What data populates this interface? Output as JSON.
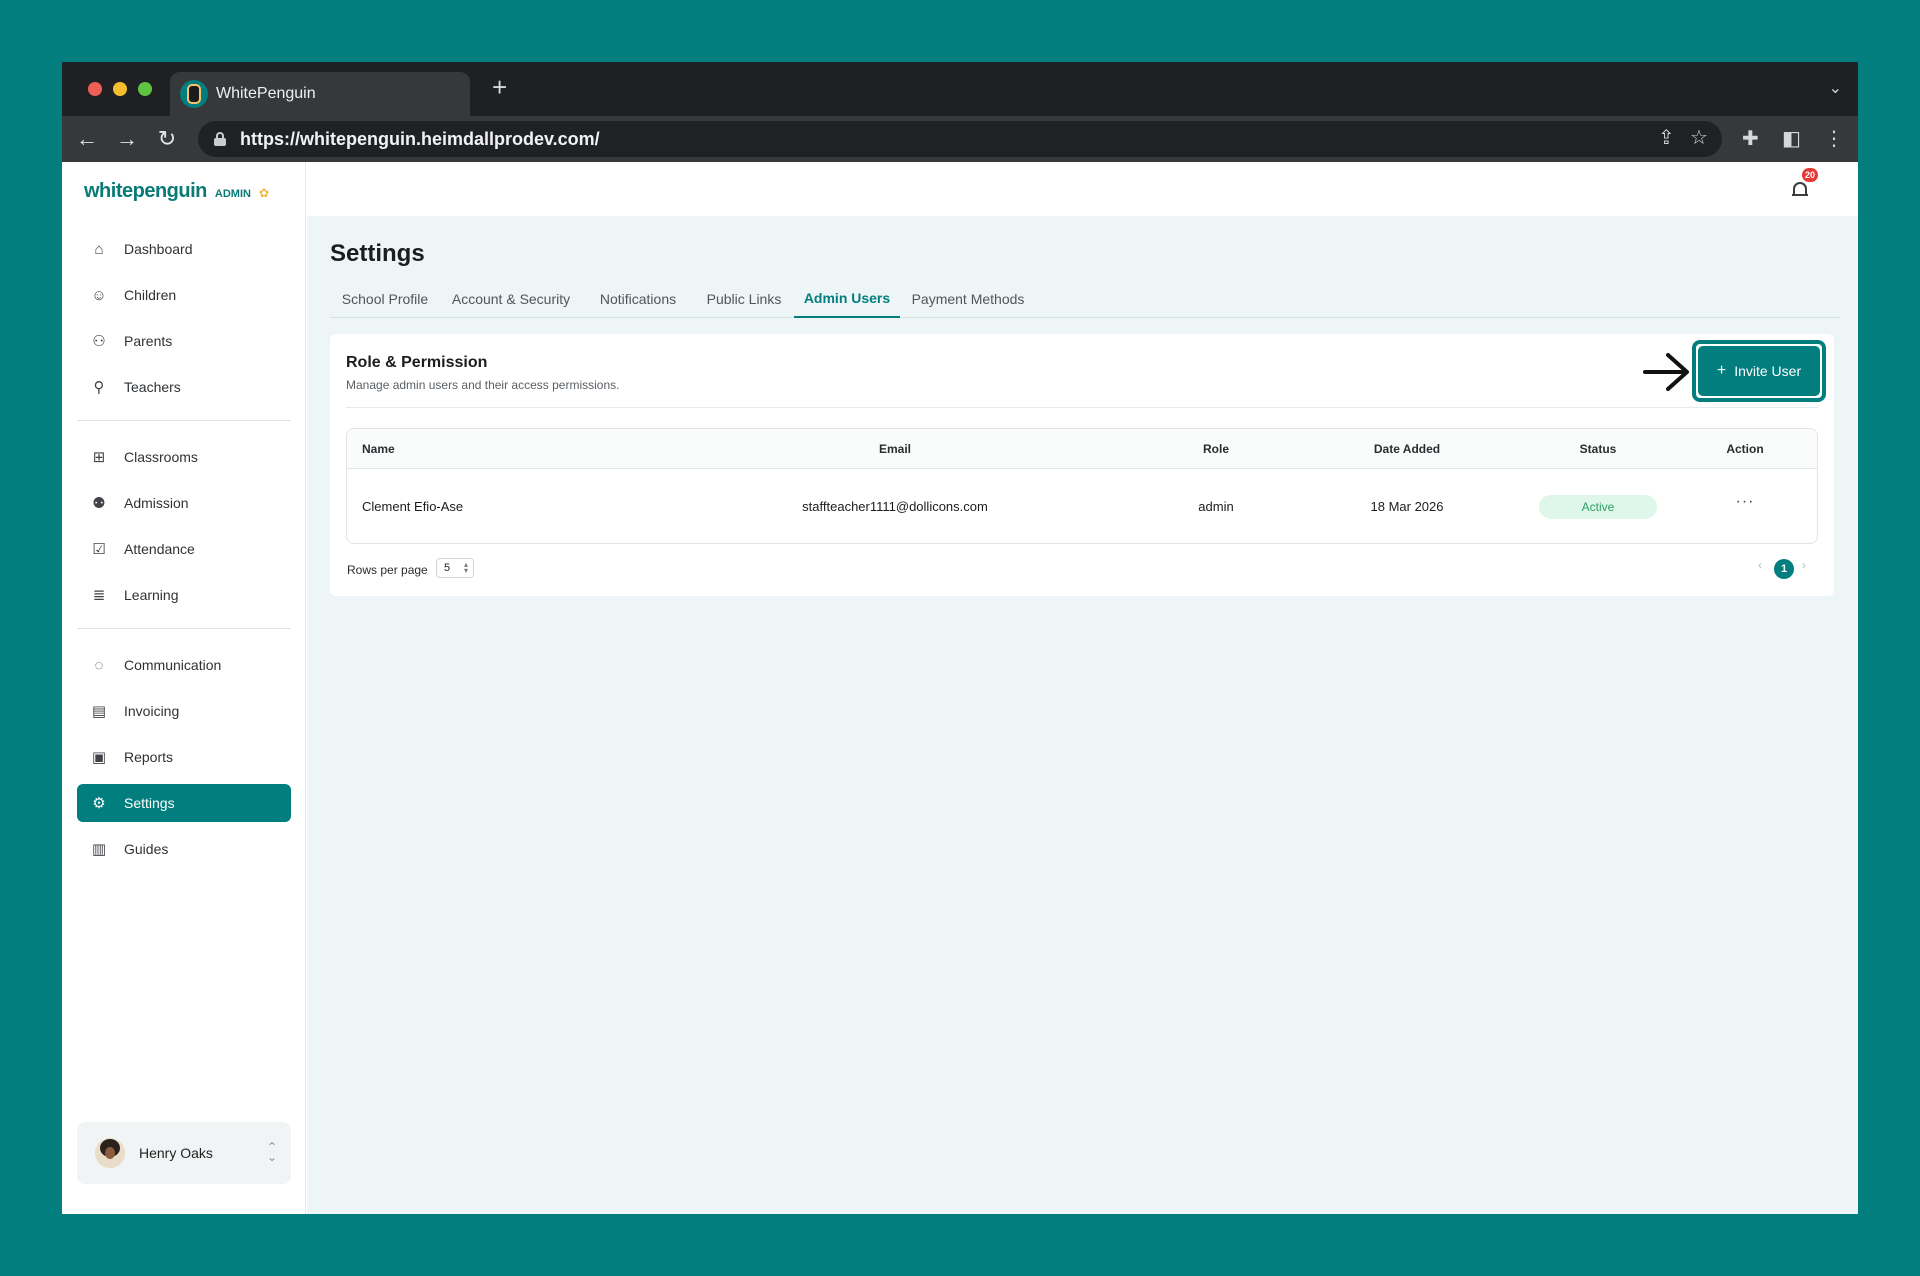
{
  "browser": {
    "tab_title": "WhitePenguin",
    "new_tab_symbol": "+",
    "url": "https://whitepenguin.heimdallprodev.com/"
  },
  "brand": {
    "logo_text": "whitepenguin",
    "admin_label": "ADMIN",
    "accent_color": "#037e7e"
  },
  "sidebar": {
    "items": [
      {
        "label": "Dashboard",
        "icon": "dashboard-icon"
      },
      {
        "label": "Children",
        "icon": "children-icon"
      },
      {
        "label": "Parents",
        "icon": "parents-icon"
      },
      {
        "label": "Teachers",
        "icon": "teachers-icon"
      },
      {
        "label": "Classrooms",
        "icon": "classrooms-icon"
      },
      {
        "label": "Admission",
        "icon": "admission-icon"
      },
      {
        "label": "Attendance",
        "icon": "attendance-icon"
      },
      {
        "label": "Learning",
        "icon": "learning-icon"
      },
      {
        "label": "Communication",
        "icon": "communication-icon"
      },
      {
        "label": "Invoicing",
        "icon": "invoicing-icon"
      },
      {
        "label": "Reports",
        "icon": "reports-icon"
      },
      {
        "label": "Settings",
        "icon": "settings-icon"
      },
      {
        "label": "Guides",
        "icon": "guides-icon"
      }
    ],
    "active_item": "Settings",
    "user_name": "Henry Oaks"
  },
  "header": {
    "notification_count": "20"
  },
  "page": {
    "title": "Settings",
    "tabs": [
      {
        "label": "School Profile"
      },
      {
        "label": "Account & Security"
      },
      {
        "label": "Notifications"
      },
      {
        "label": "Public Links"
      },
      {
        "label": "Admin Users"
      },
      {
        "label": "Payment Methods"
      }
    ],
    "active_tab": "Admin Users"
  },
  "role_permission": {
    "title": "Role & Permission",
    "subtitle": "Manage admin users and their access permissions.",
    "invite_plus": "+",
    "invite_label": "Invite User",
    "columns": {
      "name": "Name",
      "email": "Email",
      "role": "Role",
      "date_added": "Date Added",
      "status": "Status",
      "action": "Action"
    },
    "rows": [
      {
        "name": "Clement Efio-Ase",
        "email": "staffteacher1111@dollicons.com",
        "role": "admin",
        "date_added": "18 Mar 2026",
        "status": "Active",
        "action": "···"
      }
    ],
    "rows_per_page_label": "Rows per page",
    "rows_per_page_value": "5",
    "current_page": "1"
  }
}
